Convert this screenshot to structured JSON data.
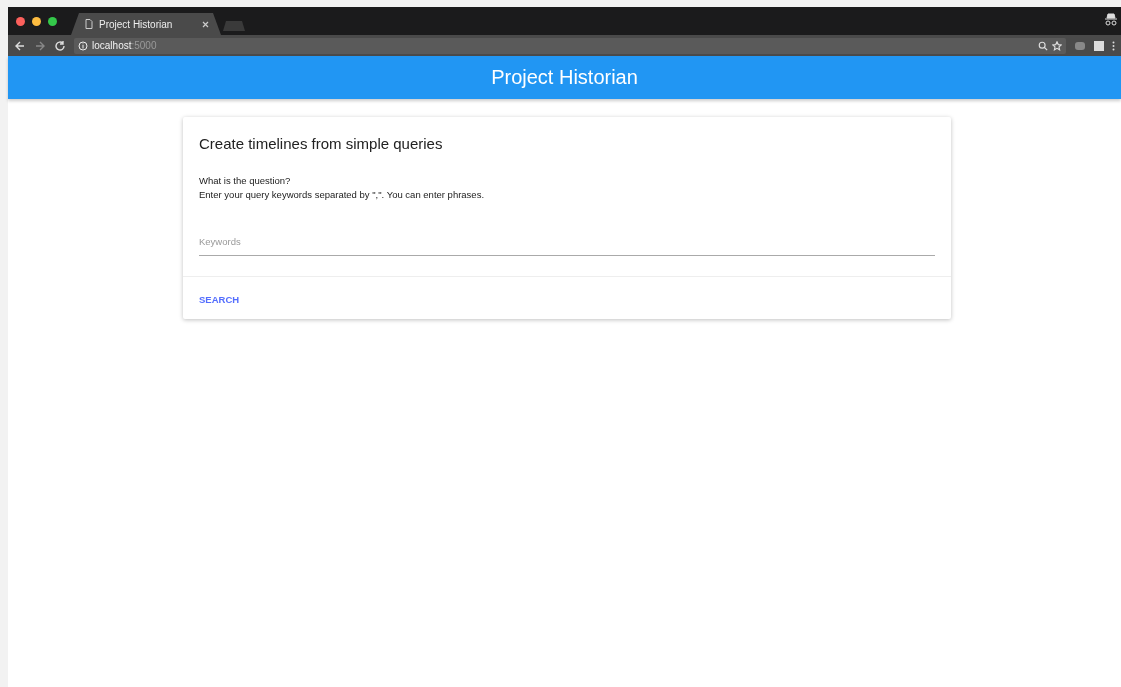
{
  "browser": {
    "tabs": [
      {
        "title": "Project Historian",
        "selected": true
      }
    ],
    "address": {
      "host": "localhost",
      "port": ":5000"
    }
  },
  "header": {
    "title": "Project Historian"
  },
  "card": {
    "title": "Create timelines from simple queries",
    "question": "What is the question?",
    "hint": "Enter your query keywords separated by \",\". You can enter phrases.",
    "field": {
      "placeholder": "Keywords"
    },
    "button": "SEARCH"
  }
}
